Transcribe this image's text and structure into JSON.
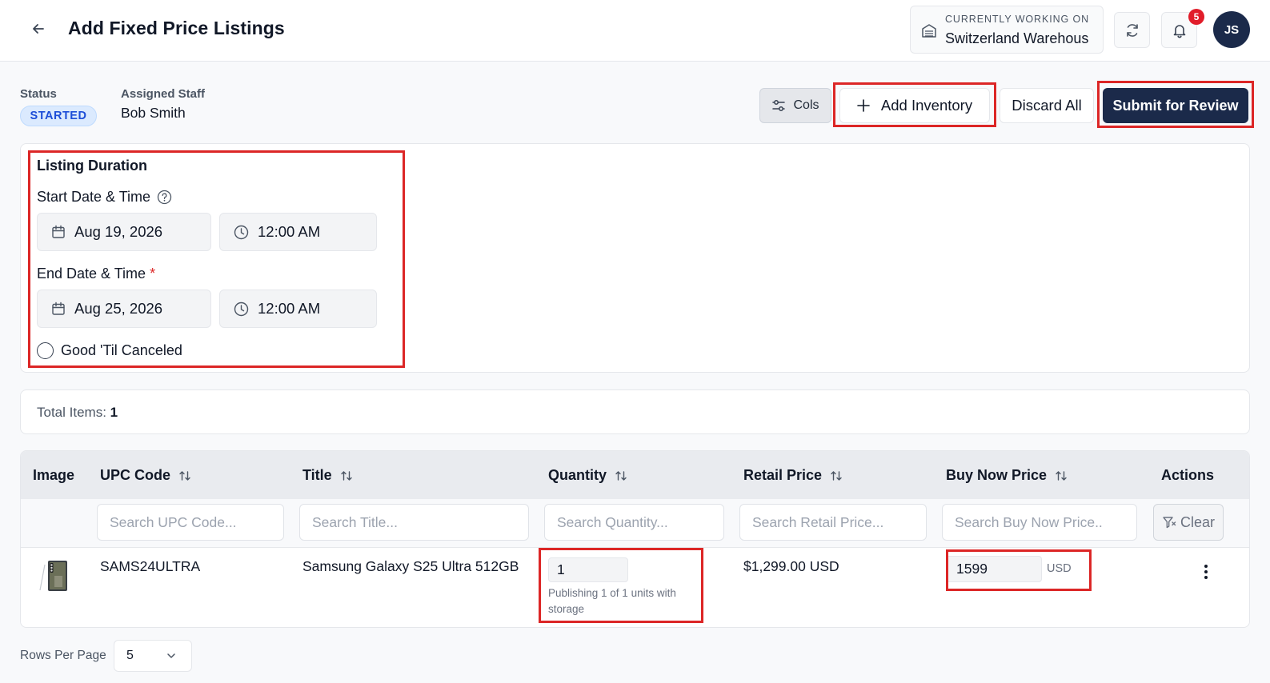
{
  "header": {
    "title": "Add Fixed Price Listings",
    "warehouse_label": "CURRENTLY WORKING ON",
    "warehouse_name": "Switzerland Warehous",
    "notification_count": "5",
    "avatar_initials": "JS"
  },
  "status": {
    "label": "Status",
    "value": "STARTED",
    "staff_label": "Assigned Staff",
    "staff_value": "Bob Smith"
  },
  "toolbar": {
    "cols_label": "Cols",
    "add_inventory_label": "Add Inventory",
    "discard_label": "Discard All",
    "submit_label": "Submit for Review"
  },
  "listing_duration": {
    "title": "Listing Duration",
    "start_label": "Start Date & Time",
    "start_date": "Aug 19, 2026",
    "start_time": "12:00 AM",
    "end_label": "End Date & Time",
    "end_required": "*",
    "end_date": "Aug 25, 2026",
    "end_time": "12:00 AM",
    "gtc_label": "Good 'Til Canceled"
  },
  "totals": {
    "label": "Total Items:",
    "count": "1"
  },
  "table": {
    "columns": [
      "Image",
      "UPC Code",
      "Title",
      "Quantity",
      "Retail Price",
      "Buy Now Price",
      "Actions"
    ],
    "filters": {
      "upc": "Search UPC Code...",
      "title": "Search Title...",
      "quantity": "Search Quantity...",
      "retail": "Search Retail Price...",
      "buy_now": "Search Buy Now Price.."
    },
    "clear_label": "Clear",
    "rows": [
      {
        "upc": "SAMS24ULTRA",
        "title": "Samsung Galaxy S25 Ultra 512GB",
        "quantity": "1",
        "quantity_help": "Publishing 1 of 1 units with storage",
        "retail_price": "$1,299.00 USD",
        "buy_now_price": "1599",
        "currency": "USD"
      }
    ]
  },
  "pagination": {
    "rows_label": "Rows Per Page",
    "rows_value": "5"
  },
  "colors": {
    "primary": "#1b2a4a",
    "badge": "#e11d2a",
    "highlight": "#dc2626",
    "status_bg": "#dbeafe",
    "status_text": "#1d4ed8"
  }
}
